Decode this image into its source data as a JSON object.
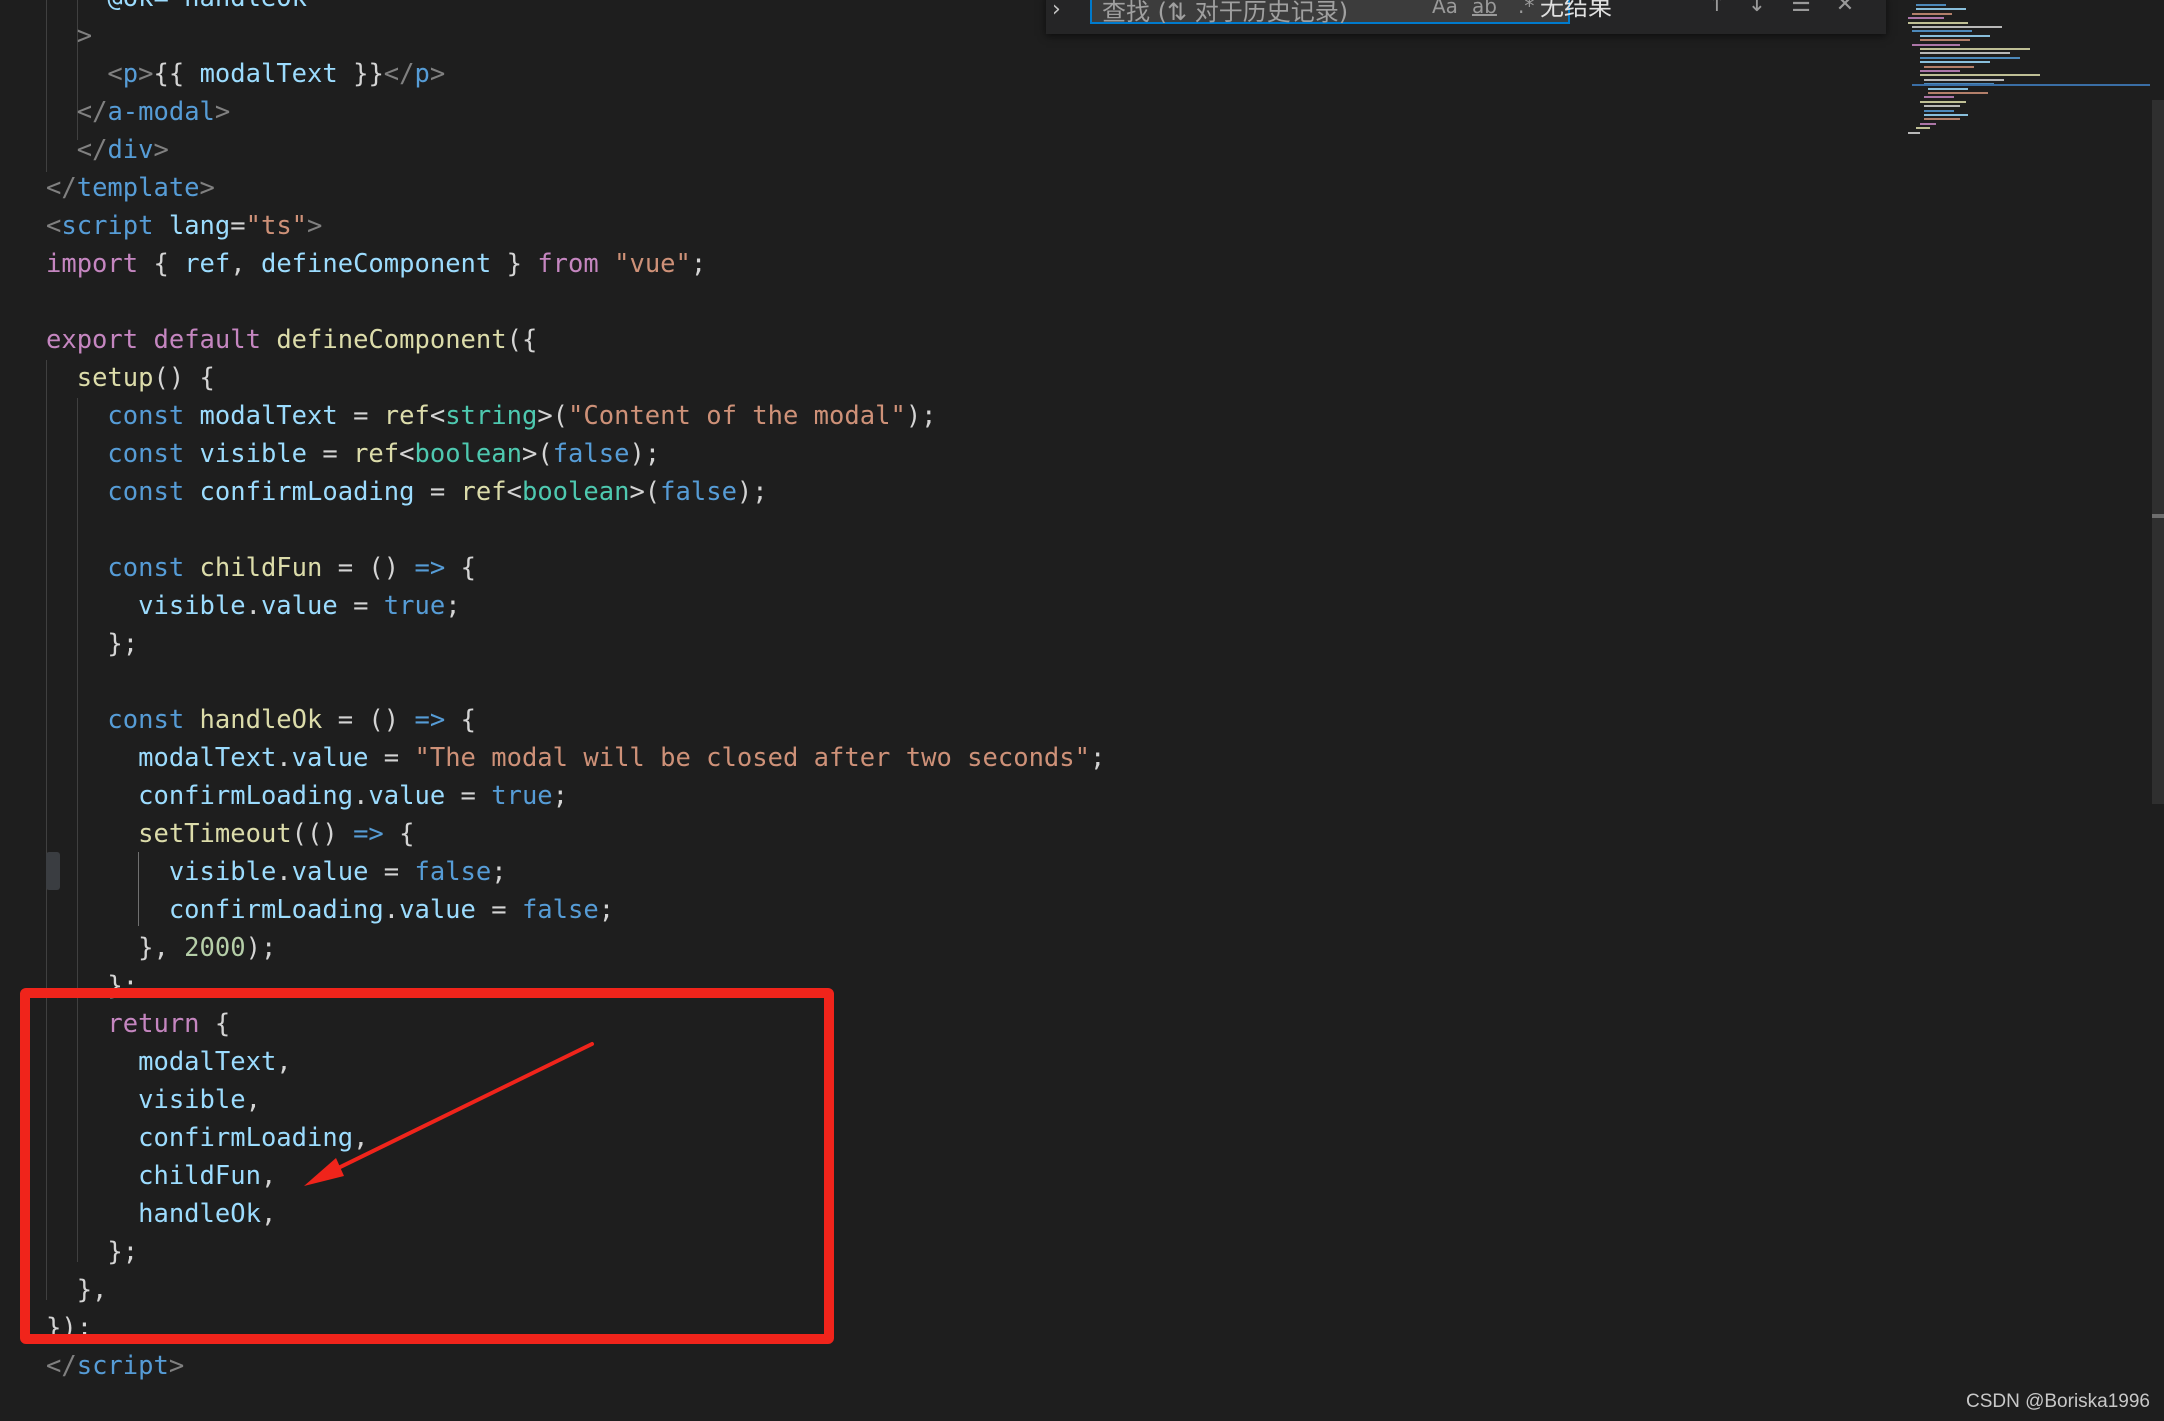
{
  "editor": {
    "language": "vue",
    "lines": [
      [
        {
          "t": "    @ok=\"handleOk\"",
          "c": "attr"
        }
      ],
      [
        {
          "t": "  >",
          "c": "punct"
        }
      ],
      [
        {
          "t": "    ",
          "c": "plain"
        },
        {
          "t": "<",
          "c": "punct"
        },
        {
          "t": "p",
          "c": "tag"
        },
        {
          "t": ">",
          "c": "punct"
        },
        {
          "t": "{{ ",
          "c": "plain"
        },
        {
          "t": "modalText",
          "c": "var"
        },
        {
          "t": " }}",
          "c": "plain"
        },
        {
          "t": "</",
          "c": "punct"
        },
        {
          "t": "p",
          "c": "tag"
        },
        {
          "t": ">",
          "c": "punct"
        }
      ],
      [
        {
          "t": "  ",
          "c": "plain"
        },
        {
          "t": "</",
          "c": "punct"
        },
        {
          "t": "a-modal",
          "c": "tag"
        },
        {
          "t": ">",
          "c": "punct"
        }
      ],
      [
        {
          "t": "  ",
          "c": "plain"
        },
        {
          "t": "</",
          "c": "punct"
        },
        {
          "t": "div",
          "c": "tag"
        },
        {
          "t": ">",
          "c": "punct"
        }
      ],
      [
        {
          "t": "</",
          "c": "punct"
        },
        {
          "t": "template",
          "c": "tag"
        },
        {
          "t": ">",
          "c": "punct"
        }
      ],
      [
        {
          "t": "<",
          "c": "punct"
        },
        {
          "t": "script",
          "c": "tag"
        },
        {
          "t": " ",
          "c": "plain"
        },
        {
          "t": "lang",
          "c": "attr"
        },
        {
          "t": "=",
          "c": "plain"
        },
        {
          "t": "\"ts\"",
          "c": "str"
        },
        {
          "t": ">",
          "c": "punct"
        }
      ],
      [
        {
          "t": "import",
          "c": "kw"
        },
        {
          "t": " { ",
          "c": "plain"
        },
        {
          "t": "ref",
          "c": "var"
        },
        {
          "t": ", ",
          "c": "plain"
        },
        {
          "t": "defineComponent",
          "c": "var"
        },
        {
          "t": " } ",
          "c": "plain"
        },
        {
          "t": "from",
          "c": "kw"
        },
        {
          "t": " ",
          "c": "plain"
        },
        {
          "t": "\"vue\"",
          "c": "str"
        },
        {
          "t": ";",
          "c": "plain"
        }
      ],
      [],
      [
        {
          "t": "export",
          "c": "kw"
        },
        {
          "t": " ",
          "c": "plain"
        },
        {
          "t": "default",
          "c": "kw"
        },
        {
          "t": " ",
          "c": "plain"
        },
        {
          "t": "defineComponent",
          "c": "fn"
        },
        {
          "t": "({",
          "c": "plain"
        }
      ],
      [
        {
          "t": "  ",
          "c": "plain"
        },
        {
          "t": "setup",
          "c": "fn"
        },
        {
          "t": "() {",
          "c": "plain"
        }
      ],
      [
        {
          "t": "    ",
          "c": "plain"
        },
        {
          "t": "const",
          "c": "decl"
        },
        {
          "t": " ",
          "c": "plain"
        },
        {
          "t": "modalText",
          "c": "var"
        },
        {
          "t": " = ",
          "c": "plain"
        },
        {
          "t": "ref",
          "c": "fn"
        },
        {
          "t": "<",
          "c": "plain"
        },
        {
          "t": "string",
          "c": "type"
        },
        {
          "t": ">(",
          "c": "plain"
        },
        {
          "t": "\"Content of the modal\"",
          "c": "str"
        },
        {
          "t": ");",
          "c": "plain"
        }
      ],
      [
        {
          "t": "    ",
          "c": "plain"
        },
        {
          "t": "const",
          "c": "decl"
        },
        {
          "t": " ",
          "c": "plain"
        },
        {
          "t": "visible",
          "c": "var"
        },
        {
          "t": " = ",
          "c": "plain"
        },
        {
          "t": "ref",
          "c": "fn"
        },
        {
          "t": "<",
          "c": "plain"
        },
        {
          "t": "boolean",
          "c": "type"
        },
        {
          "t": ">(",
          "c": "plain"
        },
        {
          "t": "false",
          "c": "decl"
        },
        {
          "t": ");",
          "c": "plain"
        }
      ],
      [
        {
          "t": "    ",
          "c": "plain"
        },
        {
          "t": "const",
          "c": "decl"
        },
        {
          "t": " ",
          "c": "plain"
        },
        {
          "t": "confirmLoading",
          "c": "var"
        },
        {
          "t": " = ",
          "c": "plain"
        },
        {
          "t": "ref",
          "c": "fn"
        },
        {
          "t": "<",
          "c": "plain"
        },
        {
          "t": "boolean",
          "c": "type"
        },
        {
          "t": ">(",
          "c": "plain"
        },
        {
          "t": "false",
          "c": "decl"
        },
        {
          "t": ");",
          "c": "plain"
        }
      ],
      [],
      [
        {
          "t": "    ",
          "c": "plain"
        },
        {
          "t": "const",
          "c": "decl"
        },
        {
          "t": " ",
          "c": "plain"
        },
        {
          "t": "childFun",
          "c": "fn"
        },
        {
          "t": " = () ",
          "c": "plain"
        },
        {
          "t": "=>",
          "c": "decl"
        },
        {
          "t": " {",
          "c": "plain"
        }
      ],
      [
        {
          "t": "      ",
          "c": "plain"
        },
        {
          "t": "visible",
          "c": "var"
        },
        {
          "t": ".",
          "c": "plain"
        },
        {
          "t": "value",
          "c": "var"
        },
        {
          "t": " = ",
          "c": "plain"
        },
        {
          "t": "true",
          "c": "decl"
        },
        {
          "t": ";",
          "c": "plain"
        }
      ],
      [
        {
          "t": "    };",
          "c": "plain"
        }
      ],
      [],
      [
        {
          "t": "    ",
          "c": "plain"
        },
        {
          "t": "const",
          "c": "decl"
        },
        {
          "t": " ",
          "c": "plain"
        },
        {
          "t": "handleOk",
          "c": "fn"
        },
        {
          "t": " = () ",
          "c": "plain"
        },
        {
          "t": "=>",
          "c": "decl"
        },
        {
          "t": " {",
          "c": "plain"
        }
      ],
      [
        {
          "t": "      ",
          "c": "plain"
        },
        {
          "t": "modalText",
          "c": "var"
        },
        {
          "t": ".",
          "c": "plain"
        },
        {
          "t": "value",
          "c": "var"
        },
        {
          "t": " = ",
          "c": "plain"
        },
        {
          "t": "\"The modal will be closed after two seconds\"",
          "c": "str"
        },
        {
          "t": ";",
          "c": "plain"
        }
      ],
      [
        {
          "t": "      ",
          "c": "plain"
        },
        {
          "t": "confirmLoading",
          "c": "var"
        },
        {
          "t": ".",
          "c": "plain"
        },
        {
          "t": "value",
          "c": "var"
        },
        {
          "t": " = ",
          "c": "plain"
        },
        {
          "t": "true",
          "c": "decl"
        },
        {
          "t": ";",
          "c": "plain"
        }
      ],
      [
        {
          "t": "      ",
          "c": "plain"
        },
        {
          "t": "setTimeout",
          "c": "fn"
        },
        {
          "t": "(() ",
          "c": "plain"
        },
        {
          "t": "=>",
          "c": "decl"
        },
        {
          "t": " {",
          "c": "plain"
        }
      ],
      [
        {
          "t": "        ",
          "c": "plain"
        },
        {
          "t": "visible",
          "c": "var"
        },
        {
          "t": ".",
          "c": "plain"
        },
        {
          "t": "value",
          "c": "var"
        },
        {
          "t": " = ",
          "c": "plain"
        },
        {
          "t": "false",
          "c": "decl"
        },
        {
          "t": ";",
          "c": "plain"
        }
      ],
      [
        {
          "t": "        ",
          "c": "plain"
        },
        {
          "t": "confirmLoading",
          "c": "var"
        },
        {
          "t": ".",
          "c": "plain"
        },
        {
          "t": "value",
          "c": "var"
        },
        {
          "t": " = ",
          "c": "plain"
        },
        {
          "t": "false",
          "c": "decl"
        },
        {
          "t": ";",
          "c": "plain"
        }
      ],
      [
        {
          "t": "      }, ",
          "c": "plain"
        },
        {
          "t": "2000",
          "c": "num"
        },
        {
          "t": ");",
          "c": "plain"
        }
      ],
      [
        {
          "t": "    };",
          "c": "plain"
        }
      ],
      [
        {
          "t": "    ",
          "c": "plain"
        },
        {
          "t": "return",
          "c": "kw"
        },
        {
          "t": " {",
          "c": "plain"
        }
      ],
      [
        {
          "t": "      ",
          "c": "plain"
        },
        {
          "t": "modalText",
          "c": "var"
        },
        {
          "t": ",",
          "c": "plain"
        }
      ],
      [
        {
          "t": "      ",
          "c": "plain"
        },
        {
          "t": "visible",
          "c": "var"
        },
        {
          "t": ",",
          "c": "plain"
        }
      ],
      [
        {
          "t": "      ",
          "c": "plain"
        },
        {
          "t": "confirmLoading",
          "c": "var"
        },
        {
          "t": ",",
          "c": "plain"
        }
      ],
      [
        {
          "t": "      ",
          "c": "plain"
        },
        {
          "t": "childFun",
          "c": "var"
        },
        {
          "t": ",",
          "c": "plain"
        }
      ],
      [
        {
          "t": "      ",
          "c": "plain"
        },
        {
          "t": "handleOk",
          "c": "var"
        },
        {
          "t": ",",
          "c": "plain"
        }
      ],
      [
        {
          "t": "    };",
          "c": "plain"
        }
      ],
      [
        {
          "t": "  },",
          "c": "plain"
        }
      ],
      [
        {
          "t": "});",
          "c": "plain"
        }
      ],
      [
        {
          "t": "</",
          "c": "punct"
        },
        {
          "t": "script",
          "c": "tag"
        },
        {
          "t": ">",
          "c": "punct"
        }
      ]
    ]
  },
  "find_widget": {
    "toggle_icon": "chevron-right-icon",
    "placeholder": "查找 (⇅ 对于历史记录)",
    "match_case": "Aa",
    "whole_word": "ab",
    "regex": ".*",
    "result": "无结果",
    "prev_icon": "arrow-up-icon",
    "next_icon": "arrow-down-icon",
    "selection_icon": "find-in-selection-icon",
    "close_icon": "close-icon"
  },
  "annotation": {
    "box_color": "#f0241b",
    "arrow_color": "#f0241b"
  },
  "watermark": "CSDN @Boriska1996",
  "colors": {
    "background": "#1e1e1e",
    "keyword": "#c586c0",
    "declaration": "#569cd6",
    "variable": "#9cdcfe",
    "function": "#dcdcaa",
    "string": "#ce9178",
    "type": "#4ec9b0",
    "number": "#b5cea8",
    "punctuation": "#808080"
  }
}
